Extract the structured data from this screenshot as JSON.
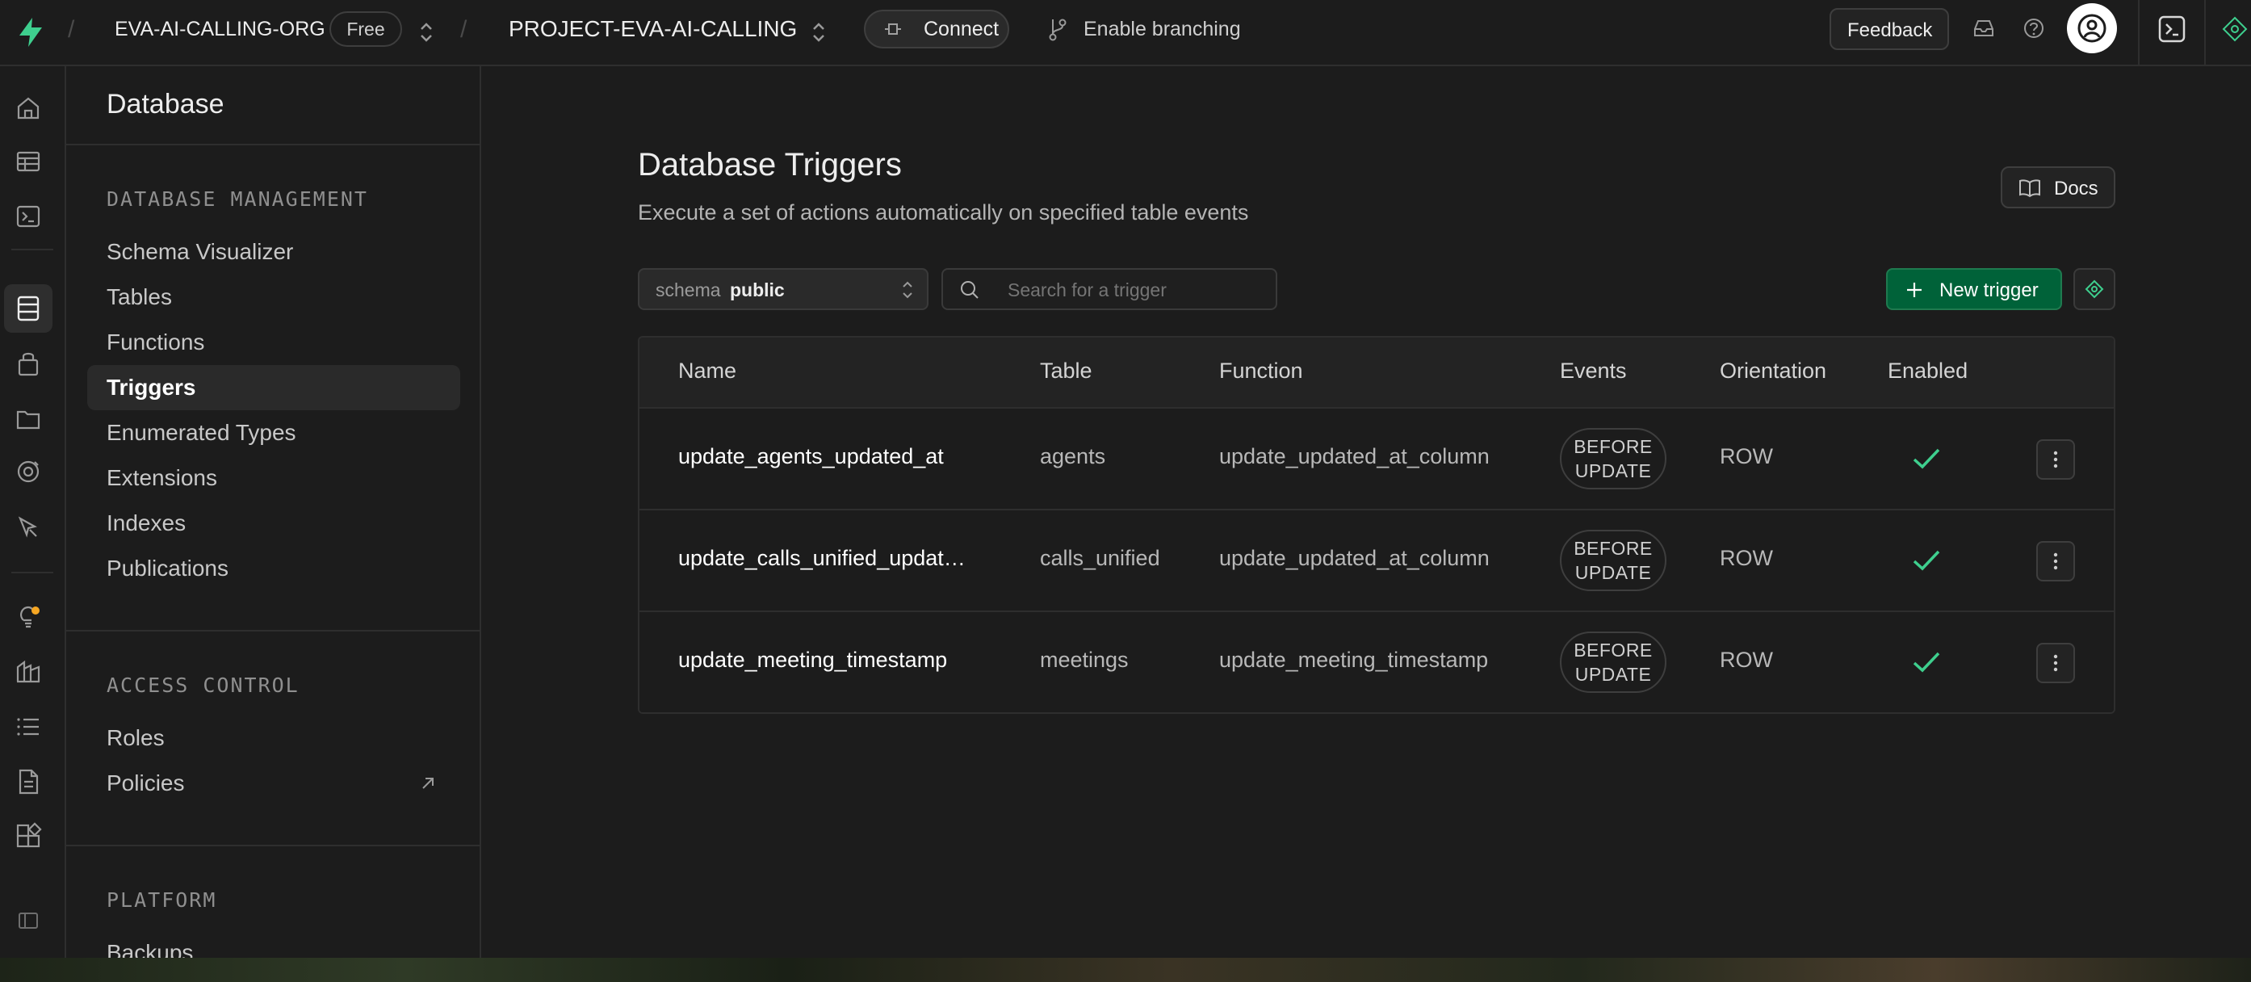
{
  "topbar": {
    "org_name": "EVA-AI-CALLING-ORG",
    "plan_badge": "Free",
    "project_name": "PROJECT-EVA-AI-CALLING",
    "connect_label": "Connect",
    "branching_label": "Enable branching",
    "feedback_label": "Feedback",
    "separator": "/"
  },
  "rail": {
    "icons": [
      "home-icon",
      "table-editor-icon",
      "sql-editor-icon",
      "database-icon",
      "auth-icon",
      "storage-icon",
      "realtime-icon",
      "edge-functions-icon",
      "advisors-icon",
      "reports-icon",
      "logs-icon",
      "api-docs-icon",
      "integrations-icon",
      "settings-icon"
    ]
  },
  "sidebar": {
    "title": "Database",
    "sections": [
      {
        "heading": "DATABASE MANAGEMENT",
        "items": [
          "Schema Visualizer",
          "Tables",
          "Functions",
          "Triggers",
          "Enumerated Types",
          "Extensions",
          "Indexes",
          "Publications"
        ]
      },
      {
        "heading": "ACCESS CONTROL",
        "items": [
          "Roles",
          "Policies"
        ]
      },
      {
        "heading": "PLATFORM",
        "items": [
          "Backups"
        ]
      }
    ],
    "active_item": "Triggers"
  },
  "main": {
    "title": "Database Triggers",
    "subtitle": "Execute a set of actions automatically on specified table events",
    "docs_label": "Docs",
    "schema_prefix": "schema",
    "schema_value": "public",
    "search_placeholder": "Search for a trigger",
    "new_trigger_label": "New trigger",
    "table": {
      "columns": [
        "Name",
        "Table",
        "Function",
        "Events",
        "Orientation",
        "Enabled"
      ],
      "rows": [
        {
          "name": "update_agents_updated_at",
          "table": "agents",
          "function": "update_updated_at_column",
          "event_line1": "BEFORE",
          "event_line2": "UPDATE",
          "orientation": "ROW",
          "enabled": true
        },
        {
          "name": "update_calls_unified_updat…",
          "table": "calls_unified",
          "function": "update_updated_at_column",
          "event_line1": "BEFORE",
          "event_line2": "UPDATE",
          "orientation": "ROW",
          "enabled": true
        },
        {
          "name": "update_meeting_timestamp",
          "table": "meetings",
          "function": "update_meeting_timestamp",
          "event_line1": "BEFORE",
          "event_line2": "UPDATE",
          "orientation": "ROW",
          "enabled": true
        }
      ]
    }
  },
  "colors": {
    "background": "#1c1c1c",
    "border": "#2e2e2e",
    "brand_green": "#3ecf8e",
    "button_green": "#006239",
    "notification_dot": "#f5a623"
  }
}
